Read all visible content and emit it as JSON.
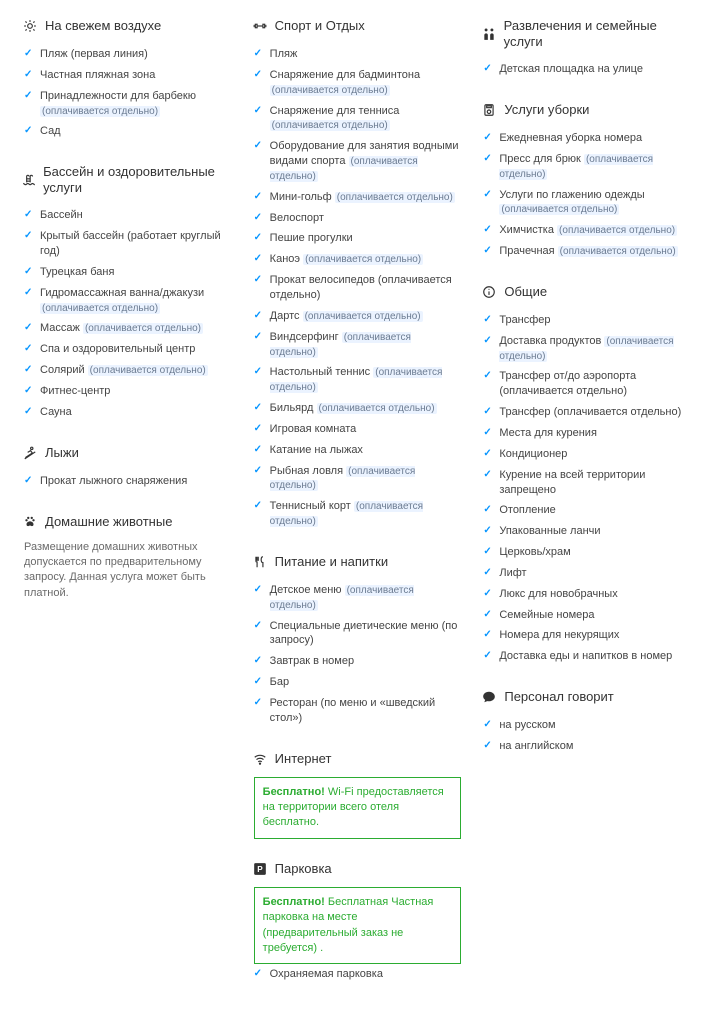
{
  "paid_label": "(оплачивается отдельно)",
  "free_label": "Бесплатно!",
  "columns": [
    {
      "sections": [
        {
          "id": "outdoor",
          "icon": "sun-icon",
          "title": "На свежем воздухе",
          "items": [
            {
              "text": "Пляж (первая линия)"
            },
            {
              "text": "Частная пляжная зона"
            },
            {
              "text": "Принадлежности для барбекю",
              "paid": true
            },
            {
              "text": "Сад"
            }
          ]
        },
        {
          "id": "pool",
          "icon": "pool-icon",
          "title": "Бассейн и оздоровительные услуги",
          "items": [
            {
              "text": "Бассейн"
            },
            {
              "text": "Крытый бассейн (работает круглый год)"
            },
            {
              "text": "Турецкая баня"
            },
            {
              "text": "Гидромассажная ванна/джакузи",
              "paid": true
            },
            {
              "text": "Массаж",
              "paid": true
            },
            {
              "text": "Спа и оздоровительный центр"
            },
            {
              "text": "Солярий",
              "paid": true
            },
            {
              "text": "Фитнес-центр"
            },
            {
              "text": "Сауна"
            }
          ]
        },
        {
          "id": "ski",
          "icon": "ski-icon",
          "title": "Лыжи",
          "items": [
            {
              "text": "Прокат лыжного снаряжения"
            }
          ]
        },
        {
          "id": "pets",
          "icon": "pets-icon",
          "title": "Домашние животные",
          "description": "Размещение домашних животных допускается по предварительному запросу. Данная услуга может быть платной."
        }
      ]
    },
    {
      "sections": [
        {
          "id": "sport",
          "icon": "sport-icon",
          "title": "Спорт и Отдых",
          "items": [
            {
              "text": "Пляж"
            },
            {
              "text": "Снаряжение для бадминтона",
              "paid": true
            },
            {
              "text": "Снаряжение для тенниса",
              "paid": true
            },
            {
              "text": "Оборудование для занятия водными видами спорта",
              "paid": true
            },
            {
              "text": "Мини-гольф",
              "paid": true
            },
            {
              "text": "Велоспорт"
            },
            {
              "text": "Пешие прогулки"
            },
            {
              "text": "Каноэ",
              "paid": true
            },
            {
              "text": "Прокат велосипедов (оплачивается отдельно)"
            },
            {
              "text": "Дартс",
              "paid": true
            },
            {
              "text": "Виндсерфинг",
              "paid": true
            },
            {
              "text": "Настольный теннис",
              "paid": true
            },
            {
              "text": "Бильярд",
              "paid": true
            },
            {
              "text": "Игровая комната"
            },
            {
              "text": "Катание на лыжах"
            },
            {
              "text": "Рыбная ловля",
              "paid": true
            },
            {
              "text": "Теннисный корт",
              "paid": true
            }
          ]
        },
        {
          "id": "food",
          "icon": "food-icon",
          "title": "Питание и напитки",
          "items": [
            {
              "text": "Детское меню",
              "paid": true
            },
            {
              "text": "Специальные диетические меню (по запросу)"
            },
            {
              "text": "Завтрак в номер"
            },
            {
              "text": "Бар"
            },
            {
              "text": "Ресторан (по меню и «шведский стол»)"
            }
          ]
        },
        {
          "id": "internet",
          "icon": "wifi-icon",
          "title": "Интернет",
          "free_text": "Wi-Fi предоставляется на территории всего отеля бесплатно."
        },
        {
          "id": "parking",
          "icon": "parking-icon",
          "title": "Парковка",
          "free_text": "Бесплатная Частная парковка на месте (предварительный заказ не требуется) .",
          "items": [
            {
              "text": "Охраняемая парковка"
            }
          ]
        }
      ]
    },
    {
      "sections": [
        {
          "id": "family",
          "icon": "family-icon",
          "title": "Развлечения и семейные услуги",
          "items": [
            {
              "text": "Детская площадка на улице"
            }
          ]
        },
        {
          "id": "cleaning",
          "icon": "cleaning-icon",
          "title": "Услуги уборки",
          "items": [
            {
              "text": "Ежедневная уборка номера"
            },
            {
              "text": "Пресс для брюк",
              "paid": true
            },
            {
              "text": "Услуги по глажению одежды",
              "paid": true
            },
            {
              "text": "Химчистка",
              "paid": true
            },
            {
              "text": "Прачечная",
              "paid": true
            }
          ]
        },
        {
          "id": "general",
          "icon": "info-icon",
          "title": "Общие",
          "items": [
            {
              "text": "Трансфер"
            },
            {
              "text": "Доставка продуктов",
              "paid": true
            },
            {
              "text": "Трансфер от/до аэропорта (оплачивается отдельно)"
            },
            {
              "text": "Трансфер (оплачивается отдельно)"
            },
            {
              "text": "Места для курения"
            },
            {
              "text": "Кондиционер"
            },
            {
              "text": "Курение на всей территории запрещено"
            },
            {
              "text": "Отопление"
            },
            {
              "text": "Упакованные ланчи"
            },
            {
              "text": "Церковь/храм"
            },
            {
              "text": "Лифт"
            },
            {
              "text": "Люкс для новобрачных"
            },
            {
              "text": "Семейные номера"
            },
            {
              "text": "Номера для некурящих"
            },
            {
              "text": "Доставка еды и напитков в номер"
            }
          ]
        },
        {
          "id": "languages",
          "icon": "speech-icon",
          "title": "Персонал говорит",
          "items": [
            {
              "text": "на русском"
            },
            {
              "text": "на английском"
            }
          ]
        }
      ]
    }
  ]
}
